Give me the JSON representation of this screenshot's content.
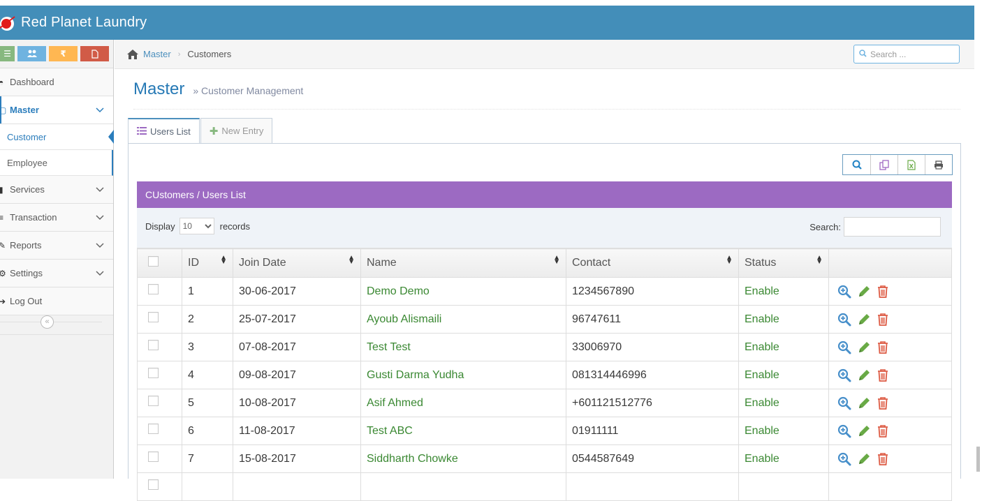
{
  "app": {
    "brand": "Red Planet Laundry"
  },
  "sidebar": {
    "shortcuts": [
      {
        "icon": "list-icon",
        "color": "#87b87f"
      },
      {
        "icon": "users-icon",
        "color": "#6fb3e0"
      },
      {
        "icon": "rupee-icon",
        "color": "#ffb752",
        "glyph": "₹"
      },
      {
        "icon": "file-icon",
        "color": "#d15b47"
      }
    ],
    "items": [
      {
        "label": "Dashboard"
      },
      {
        "label": "Master"
      },
      {
        "label": "Customer"
      },
      {
        "label": "Employee"
      },
      {
        "label": "Services"
      },
      {
        "label": "Transaction"
      },
      {
        "label": "Reports"
      },
      {
        "label": "Settings"
      },
      {
        "label": "Log Out"
      }
    ]
  },
  "breadcrumb": {
    "home": "Master",
    "current": "Customers"
  },
  "nav_search": {
    "placeholder": "Search ..."
  },
  "page": {
    "title": "Master",
    "subtitle": "» Customer Management"
  },
  "tabs": [
    {
      "label": "Users List"
    },
    {
      "label": "New Entry"
    }
  ],
  "table": {
    "title": "CUstomers / Users List",
    "display_label": "Display",
    "records_label": "records",
    "page_size": "10",
    "search_label": "Search:",
    "columns": [
      "ID",
      "Join Date",
      "Name",
      "Contact",
      "Status"
    ],
    "rows": [
      [
        "1",
        "30-06-2017",
        "Demo Demo",
        "1234567890",
        "Enable"
      ],
      [
        "2",
        "25-07-2017",
        "Ayoub Alismaili",
        "96747611",
        "Enable"
      ],
      [
        "3",
        "07-08-2017",
        "Test Test",
        "33006970",
        "Enable"
      ],
      [
        "4",
        "09-08-2017",
        "Gusti Darma Yudha",
        "081314446996",
        "Enable"
      ],
      [
        "5",
        "10-08-2017",
        "Asif Ahmed",
        "+601121512776",
        "Enable"
      ],
      [
        "6",
        "11-08-2017",
        "Test ABC",
        "01911111",
        "Enable"
      ],
      [
        "7",
        "15-08-2017",
        "Siddharth Chowke",
        "0544587649",
        "Enable"
      ]
    ]
  }
}
